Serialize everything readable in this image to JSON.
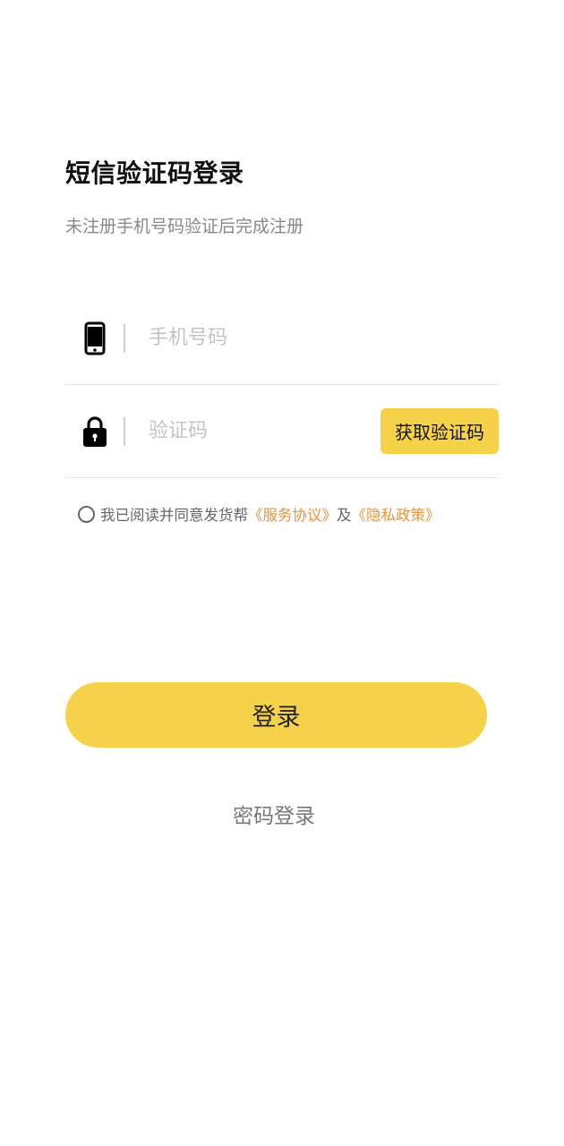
{
  "header": {
    "title": "短信验证码登录",
    "subtitle": "未注册手机号码验证后完成注册"
  },
  "form": {
    "phone": {
      "icon": "smartphone-icon",
      "placeholder": "手机号码",
      "value": ""
    },
    "code": {
      "icon": "lock-icon",
      "placeholder": "验证码",
      "value": "",
      "get_code_label": "获取验证码"
    }
  },
  "agreement": {
    "checked": false,
    "text": "我已阅读并同意发货帮",
    "service_link": "《服务协议》",
    "and_text": "及",
    "privacy_link": "《隐私政策》"
  },
  "actions": {
    "login_label": "登录",
    "password_login_label": "密码登录"
  },
  "colors": {
    "accent": "#f6d24a",
    "link": "#e8933a",
    "subtitle": "#888888",
    "placeholder": "#c4c4c4"
  }
}
